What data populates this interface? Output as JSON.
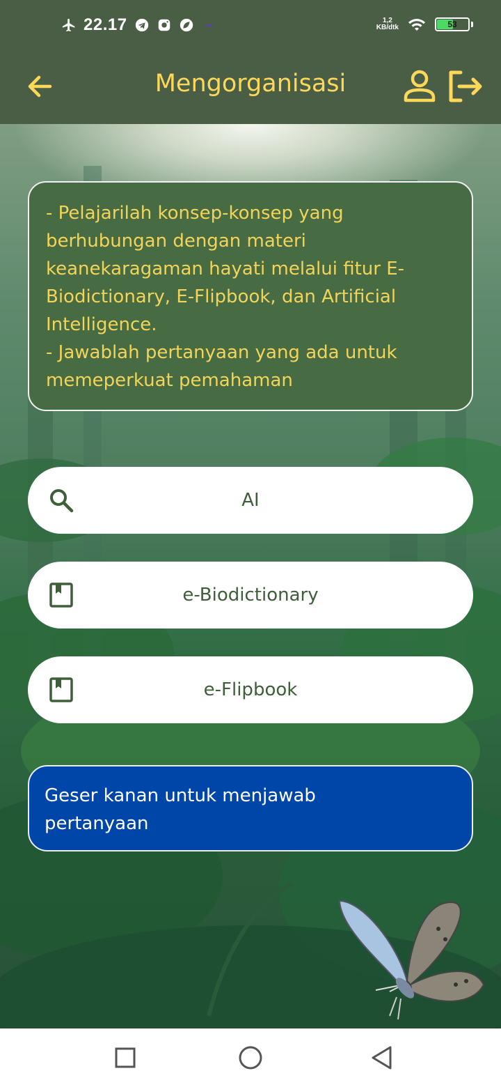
{
  "status_bar": {
    "time": "22.17",
    "net_speed_value": "1,2",
    "net_speed_unit": "KB/dtk",
    "battery_level": "53",
    "battery_fraction": 0.53,
    "icons": [
      "airplane-mode-icon",
      "telegram-icon",
      "instagram-icon",
      "leaf-app-icon",
      "dot-icon",
      "wifi-icon",
      "battery-icon"
    ]
  },
  "app_bar": {
    "title": "Mengorganisasi",
    "icons": [
      "back-arrow-icon",
      "profile-icon",
      "logout-icon"
    ],
    "accent_color": "#fbd85a",
    "background_color": "#4a5e46"
  },
  "instructions": {
    "lines": [
      "- Pelajarilah konsep-konsep yang",
      "berhubungan dengan materi",
      "keanekaragaman hayati melalui fitur E-",
      "Biodictionary, E-Flipbook, dan Artificial",
      "Intelligence.",
      "- Jawablah pertanyaan yang ada untuk",
      "memeperkuat pemahaman"
    ]
  },
  "menu": {
    "buttons": [
      {
        "label": "AI",
        "icon": "search-icon"
      },
      {
        "label": "e-Biodictionary",
        "icon": "bookmark-book-icon"
      },
      {
        "label": "e-Flipbook",
        "icon": "bookmark-book-icon"
      }
    ]
  },
  "swipe_hint": {
    "lines": [
      "Geser kanan untuk menjawab",
      "pertanyaan"
    ],
    "background_color": "#0046a8"
  },
  "nav_bar": {
    "icons": [
      "recent-apps-icon",
      "home-icon",
      "back-icon"
    ]
  }
}
